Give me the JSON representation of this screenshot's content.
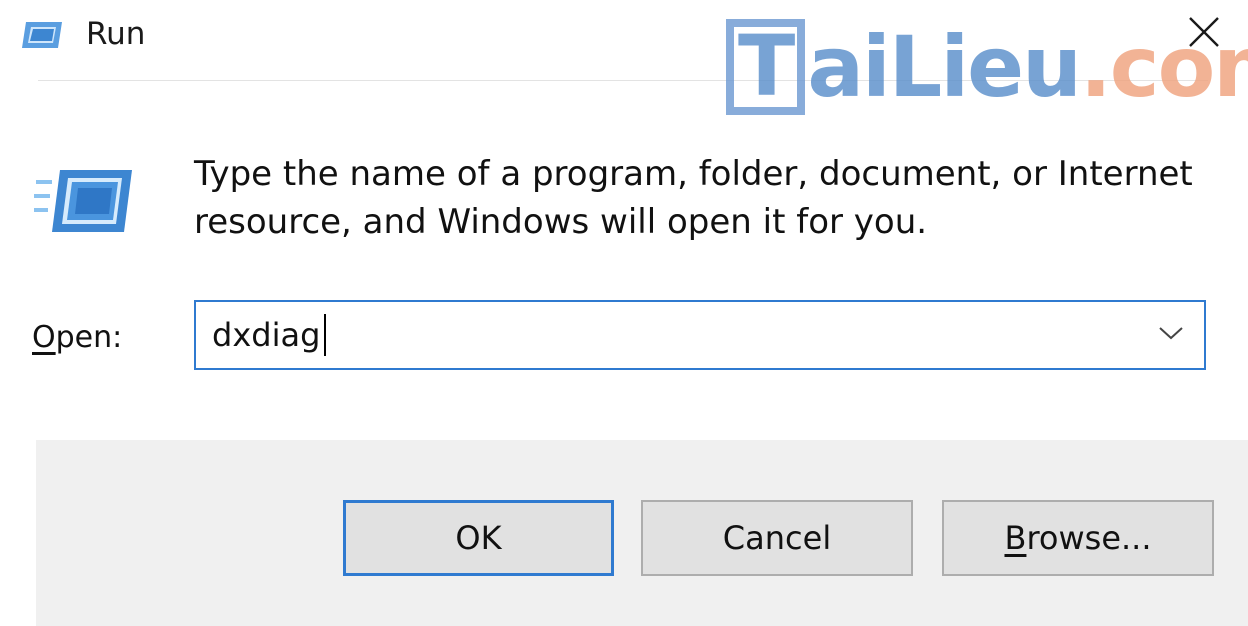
{
  "window": {
    "title": "Run",
    "title_icon": "run-icon",
    "close_icon": "close-icon"
  },
  "watermark": {
    "part1": "T",
    "part2": "ai",
    "part3": "Lieu",
    "part4": ".com"
  },
  "body": {
    "description_line1": "Type the name of a program, folder, document, or Internet",
    "description_line2": "resource, and Windows will open it for you.",
    "open_label_mnemonic": "O",
    "open_label_rest": "pen:",
    "open_value": "dxdiag",
    "dropdown_icon": "chevron-down-icon"
  },
  "buttons": {
    "ok": "OK",
    "cancel": "Cancel",
    "browse_mnemonic": "B",
    "browse_rest": "rowse..."
  },
  "colors": {
    "accent": "#2f7ad0",
    "footer_bg": "#f0f0f0",
    "button_bg": "#e1e1e1",
    "watermark_blue": "#5b8fcb",
    "watermark_orange": "#f0a37e"
  }
}
